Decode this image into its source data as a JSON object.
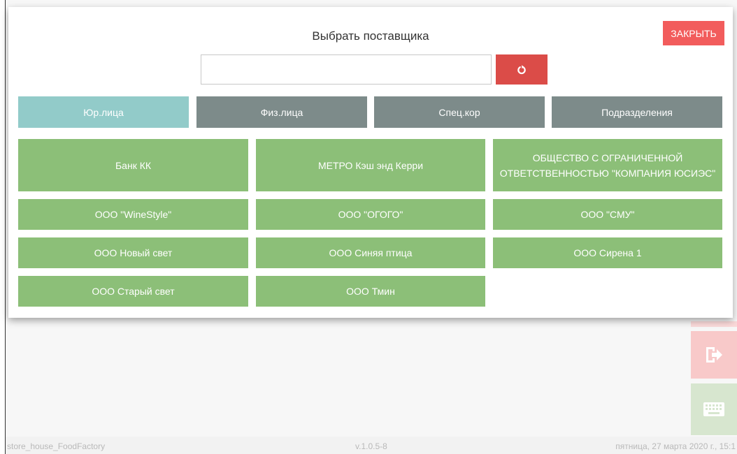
{
  "modal": {
    "title": "Выбрать поставщика",
    "close_label": "ЗАКРЫТЬ",
    "search": {
      "value": "",
      "placeholder": ""
    }
  },
  "tabs": [
    {
      "label": "Юр.лица",
      "active": true
    },
    {
      "label": "Физ.лица",
      "active": false
    },
    {
      "label": "Спец.кор",
      "active": false
    },
    {
      "label": "Подразделения",
      "active": false
    }
  ],
  "suppliers": [
    "Банк КК",
    "МЕТРО Кэш энд Керри",
    "ОБЩЕСТВО С ОГРАНИЧЕННОЙ ОТВЕТСТВЕННОСТЬЮ \"КОМПАНИЯ ЮСИЭС\"",
    "ООО \"WineStyle\"",
    "ООО \"ОГОГО\"",
    "ООО \"СМУ\"",
    "ООО Новый свет",
    "ООО Синяя птица",
    "ООО Сирена 1",
    "ООО Старый свет",
    "ООО Тмин"
  ],
  "footer": {
    "app_name": "store_house_FoodFactory",
    "version": "v.1.0.5-8",
    "datetime": "пятница, 27 марта 2020 г., 15:1"
  },
  "icons": {
    "reset": "refresh-icon",
    "exit": "exit-icon",
    "keyboard": "keyboard-icon"
  },
  "colors": {
    "close_button": "#f25c5c",
    "reset_button": "#db4c48",
    "tab_active": "#92cbc9",
    "tab_inactive": "#7d8b8a",
    "supplier_button": "#8cbf78"
  }
}
